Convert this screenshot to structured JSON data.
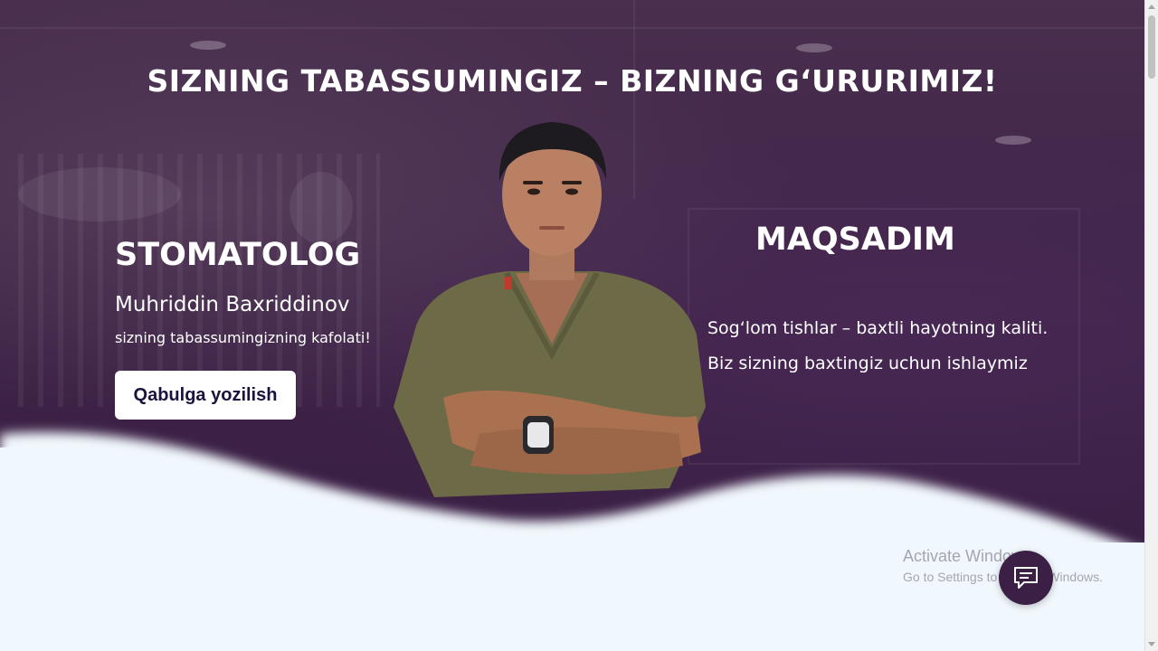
{
  "hero": {
    "headline": "SIZNING TABASSUMINGIZ – BIZNING G‘URURIMIZ!",
    "role": "STOMATOLOG",
    "name": "Muhriddin Baxriddinov",
    "tagline": "sizning tabassumingizning kafolati!",
    "cta_label": "Qabulga yozilish",
    "mission_title": "MAQSADIM",
    "mission_line1": "Sog‘lom tishlar – baxtli hayotning kaliti.",
    "mission_line2": "Biz sizning baxtingiz uchun ishlaymiz"
  },
  "watermark": {
    "title": "Activate Windows",
    "subtitle": "Go to Settings to activate Windows."
  },
  "icons": {
    "chat": "chat-bubble-icon",
    "doctor": "doctor-portrait"
  },
  "colors": {
    "hero_bg": "#3f2447",
    "wave": "#f1f8fd",
    "cta_bg": "#ffffff",
    "cta_text": "#1c1240",
    "chat_bg": "#3c1f44"
  }
}
